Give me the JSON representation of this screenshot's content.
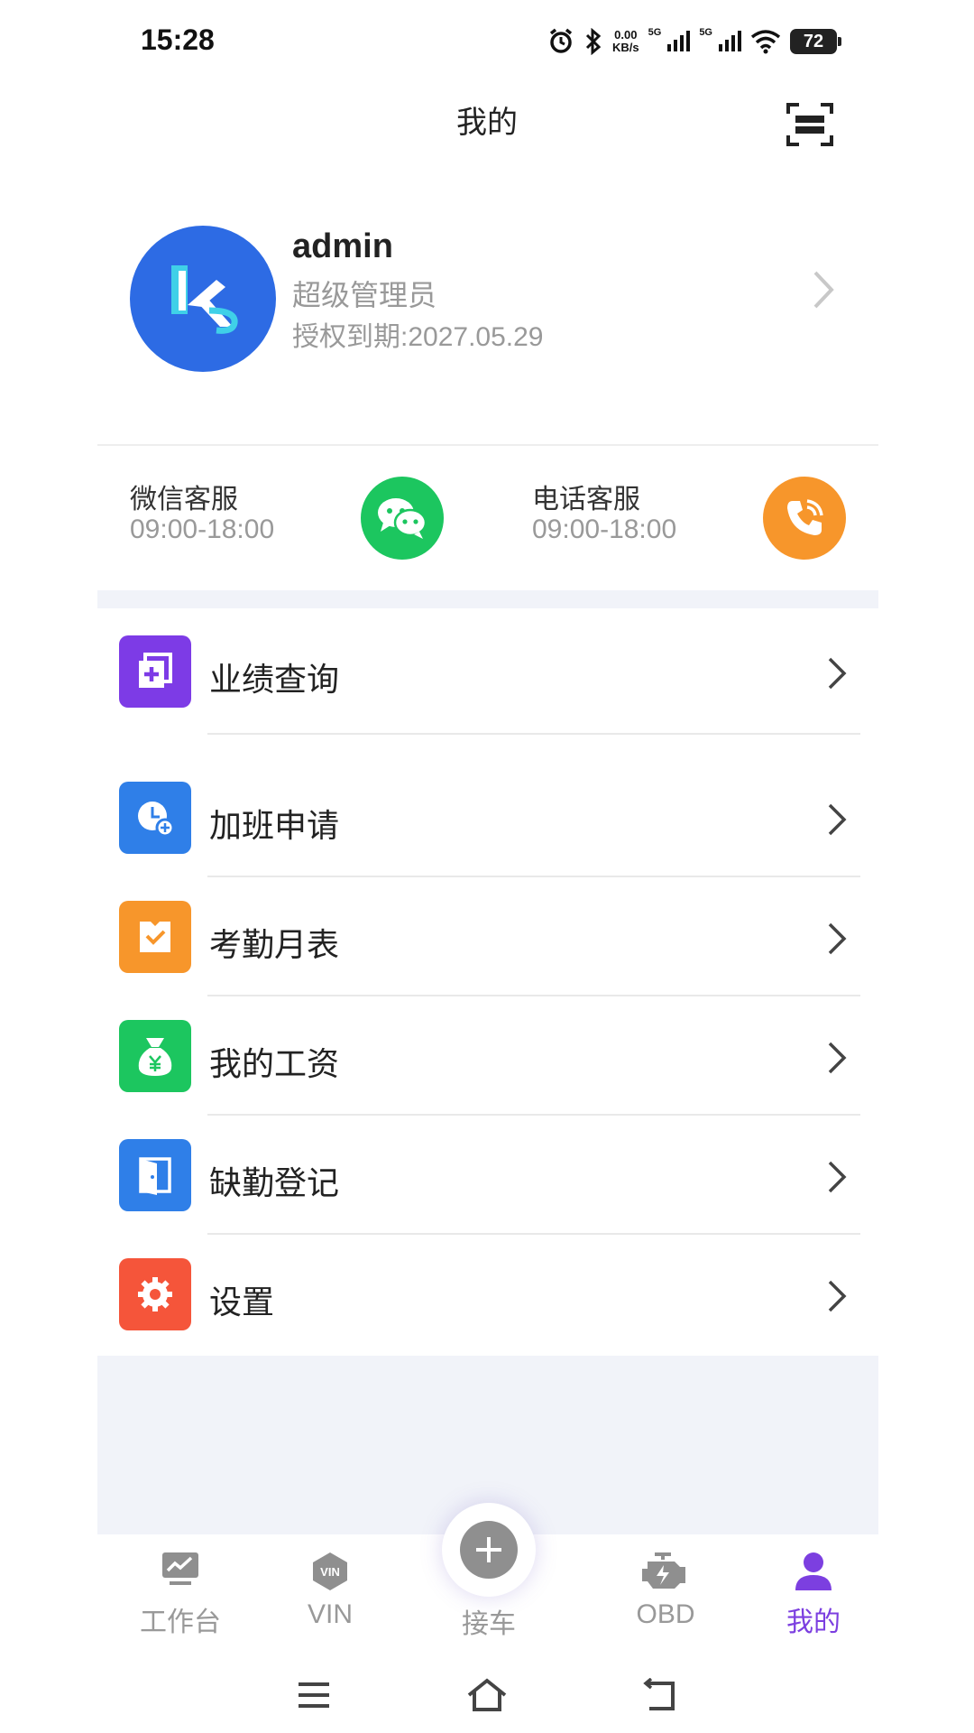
{
  "status_bar": {
    "time": "15:28",
    "net_speed_value": "0.00",
    "net_speed_unit": "KB/s",
    "signal_label_1": "5G",
    "signal_label_2": "5G",
    "battery": "72",
    "icons": [
      "alarm-icon",
      "bluetooth-icon",
      "signal-icon",
      "signal-icon",
      "wifi-icon",
      "battery-icon"
    ]
  },
  "header": {
    "title": "我的",
    "scan_icon": "scan-icon"
  },
  "profile": {
    "name": "admin",
    "role": "超级管理员",
    "expiry": "授权到期:2027.05.29"
  },
  "service": {
    "wechat": {
      "title": "微信客服",
      "hours": "09:00-18:00",
      "color": "#1cc65f"
    },
    "phone": {
      "title": "电话客服",
      "hours": "09:00-18:00",
      "color": "#f7962b"
    }
  },
  "menu": {
    "items": [
      {
        "label": "业绩查询",
        "icon": "performance-icon",
        "color": "#7d3be6"
      },
      {
        "label": "加班申请",
        "icon": "overtime-clock-icon",
        "color": "#2f7fe8"
      },
      {
        "label": "考勤月表",
        "icon": "attendance-icon",
        "color": "#f7962b"
      },
      {
        "label": "我的工资",
        "icon": "money-bag-icon",
        "color": "#1cc65f"
      },
      {
        "label": "缺勤登记",
        "icon": "door-icon",
        "color": "#2f7fe8"
      },
      {
        "label": "设置",
        "icon": "gear-icon",
        "color": "#f5553a"
      }
    ]
  },
  "tabbar": {
    "tabs": [
      {
        "label": "工作台",
        "icon": "dashboard-icon"
      },
      {
        "label": "VIN",
        "icon": "vin-icon",
        "badge": "VIN"
      },
      {
        "label": "接车",
        "icon": "plus-icon"
      },
      {
        "label": "OBD",
        "icon": "engine-icon"
      },
      {
        "label": "我的",
        "icon": "user-icon",
        "active": true
      }
    ],
    "active_color": "#7c3fe0"
  }
}
